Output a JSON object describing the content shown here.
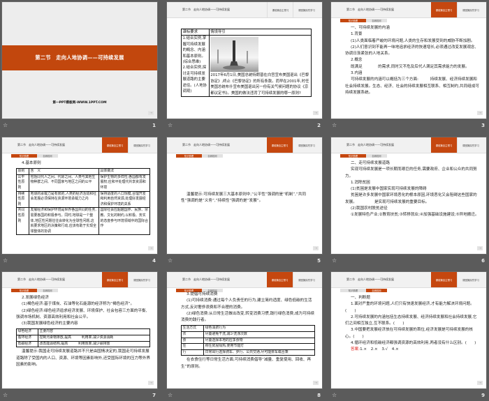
{
  "header": {
    "title": "第二节　走向人地协调——可持续发展",
    "tabs": [
      "课前篇自主预习",
      "课堂篇探究学习"
    ],
    "subtabs": [
      "知识梳理",
      "自我检测"
    ]
  },
  "slides": [
    {
      "number": "1",
      "type": "title",
      "title": "第二节　走向人地协调——可持续发展",
      "site": "第一PPT模板网-WWW.1PPT.COM"
    },
    {
      "number": "2",
      "type": "intro",
      "active_tab": -1,
      "table": {
        "head": [
          "课标要求",
          "情境导引"
        ],
        "left": "1.结合实例,掌握可持续发展的概念、内涵和基本原则。(综合思维)\n2.结合实例,探讨走可持续发展道路的主要途径。(人地协调观)",
        "right": "2017年6月1日,美国总统特朗普在白宫宣布美国退出《巴黎协定》,终止《巴黎协定》的所有条款。而早在2001年,时任美国总统布什宣布美国退出另一份有关气候问题的协议《京都议定书》。美国的做法违背了可持续发展的哪一原则?"
      }
    },
    {
      "number": "3",
      "type": "content",
      "active_tab": 0,
      "active_subtab": 0,
      "blocks": [
        {
          "t": "h",
          "text": "一、可持续发展的内涵"
        },
        {
          "t": "h",
          "text": "1.背景"
        },
        {
          "t": "i",
          "text": "(1)人类面临着严峻的环境问题,人类的生存和发展受到的威胁不断加剧。"
        },
        {
          "t": "i",
          "text": "(2)人们意识到不能再一味地追求经济的快速增长,必须通过改变发展观念,协调日渐紧张的人地关系。"
        },
        {
          "t": "h",
          "text": "2.概念"
        },
        {
          "t": "i",
          "text": "既满足　　　　的需求,同时又不危及后代人满足其需求能力的发展。"
        },
        {
          "t": "h",
          "text": "3.内涵"
        },
        {
          "t": "i",
          "text": "可持续发展的内涵可以概括为三个方面:　　　持续发展、经济持续发展和社会持续发展。生态、经济、社会的持续发展相互联系、相互制约,共同组成可持续发展系统。"
        }
      ]
    },
    {
      "number": "4",
      "type": "content",
      "active_tab": 0,
      "active_subtab": 0,
      "blocks": [
        {
          "t": "h",
          "text": "4.基本原则"
        },
        {
          "t": "table",
          "cols": [
            "18px",
            "100px",
            "73px"
          ],
          "rows": [
            [
              "原则",
              "含　义",
              "具体做法"
            ],
            [
              "公平性原则",
              "包括同代人之间、代际之间、人类与其他生物种群之间、不同国家与地区之间的公平",
              "保护生物的多样性;各国都有发展权;应和平处理代共享资源和环境"
            ],
            [
              "持续性原则",
              "地球的承载力是有限的,人类的经济活动和社会发展必须保持在资源环境承载力之内",
              "保持适度的人口规模,合理开发和利用自然资源,处理好发展经济和保护环境的关系"
            ],
            [
              "共同性原则",
              "发展经济和保护环境是世界各国共同的任务,需要各国的积极参与。同时,地球是一个整体,地区性问题往往会转化为全球性问题,这就要求地区的决策和行动,应该有助于实现全球整体的协调",
              "国际社会应超越国界、民族、宗教、文化的制约,以积极、务实的态度参与环境领域中的国际合作"
            ]
          ]
        }
      ]
    },
    {
      "number": "5",
      "type": "content",
      "active_tab": 0,
      "active_subtab": 0,
      "offset": "mid",
      "blocks": [
        {
          "t": "i",
          "text": "温馨提示:可持续发展三大基本原则中,“公平性”强调的是“机制”,“共同性”强调的是“义务”,“持续性”强调的是“发展”。"
        }
      ]
    },
    {
      "number": "6",
      "type": "content",
      "active_tab": 0,
      "active_subtab": 0,
      "blocks": [
        {
          "t": "h",
          "text": "二、走可持续发展道路"
        },
        {
          "t": "i",
          "text": "实现可持续发展是一项长期而艰巨的任务,需要政府、企业和公众的共同努力。"
        },
        {
          "t": "h",
          "text": "1.消除贫困"
        },
        {
          "t": "i",
          "text": "(1)贫困是发展中国家实现可持续发展的障碍"
        },
        {
          "t": "i",
          "text": "贫困是许多发展中国家环境恶化的根本原因,环境恶化又会阻碍这些国家的发展。　　　　　是实现可持续发展的重要目标。"
        },
        {
          "t": "i",
          "text": "(2)我国农村脱贫途径"
        },
        {
          "t": "i",
          "text": "①发展特色产业;②教育扶贫;③转移就业;④加强基础设施建设;⑤异地搬迁。"
        }
      ]
    },
    {
      "number": "7",
      "type": "content",
      "active_tab": 0,
      "active_subtab": 0,
      "blocks": [
        {
          "t": "h",
          "text": "2.发展绿色经济"
        },
        {
          "t": "i",
          "text": "(1)褐色经济:基于煤炭、石油等化石能源的经济称为“褐色经济”。"
        },
        {
          "t": "i",
          "text": "(2)绿色经济:绿色经济追求经济发展、环境保护、社会包容三方面的平衡,强调市场机制、资源高效利用和社会公平。"
        },
        {
          "t": "i",
          "text": "(3)我国发展绿色经济的主要内容"
        },
        {
          "t": "table",
          "cols": [
            "31px",
            "160px"
          ],
          "rows": [
            [
              "绿色经济",
              "主要内容"
            ],
            [
              "循环经济",
              "控制污染物排放,提高　　　利用率,减少资源消耗"
            ],
            [
              "低碳经济",
              "改善能源结构,提高　　　利用效率,减少碳排放"
            ]
          ]
        },
        {
          "t": "i",
          "text": "温馨提示:我国走可持续发展道路并不只是由国情决定的,我国走可持续发展道路除了受国内的人口、资源、环境等因素影响外,还受国际环境的压力等外界因素的影响。"
        }
      ]
    },
    {
      "number": "8",
      "type": "content",
      "active_tab": 0,
      "active_subtab": 0,
      "tight": true,
      "blocks": [
        {
          "t": "h",
          "text": "3.提倡可持续消费"
        },
        {
          "t": "i",
          "text": "(1)可持续消费:通过每个人负责任的行为,建立简约适度、绿色低碳的生活方式,反对奢侈浪费和不合理的消费。"
        },
        {
          "t": "i",
          "text": "(2)绿色消费:从日常生活做出改变,转变消费习惯,践行绿色消费,成为可持续消费的践行者。"
        },
        {
          "t": "table",
          "cols": [
            "32px",
            "158px"
          ],
          "rows": [
            [
              "生活方式",
              "绿色消费行为"
            ],
            [
              "衣",
              "尽量避免干洗,减少洗涤次数"
            ],
            [
              "食",
              "尽量选择本地的应季食物"
            ],
            [
              "住",
              "购住房屋隔热,使用节能灯"
            ],
            [
              "行",
              "日常出行选择骑车、步行、公共交通,尽可能拼车或合乘"
            ]
          ]
        },
        {
          "t": "i",
          "text": "在衣食住行等日常生活方面,可持续消费倡导“减量、重复使用、回收、再生”的原则。"
        }
      ]
    },
    {
      "number": "9",
      "type": "content",
      "active_tab": 0,
      "active_subtab": 1,
      "blocks": [
        {
          "t": "h",
          "text": "一、判断题"
        },
        {
          "t": "i",
          "text": "1.面对严重的环境问题,人们只有快速发展经济,才有能力解决环境问题。(　　)"
        },
        {
          "t": "i",
          "text": "2.可持续发展的内涵包括生态持续发展、经济持续发展和社会持续发展,它们之间相互独立,互不联系。(　　)"
        },
        {
          "t": "i",
          "text": "3.中国要把发展经济放在可持续发展的首位,经济发展是可持续发展的核心。(　　)"
        },
        {
          "t": "i",
          "text": "4.循环经济和低碳经济都强调资源的高效利用,两者没有什么区别。(　　)"
        },
        {
          "t": "i",
          "label": "答案:",
          "text": "1.×　2.×　3.√　4.×"
        }
      ]
    }
  ],
  "colors": {
    "accent": "#c5470f",
    "background": "#5b5b5b"
  }
}
